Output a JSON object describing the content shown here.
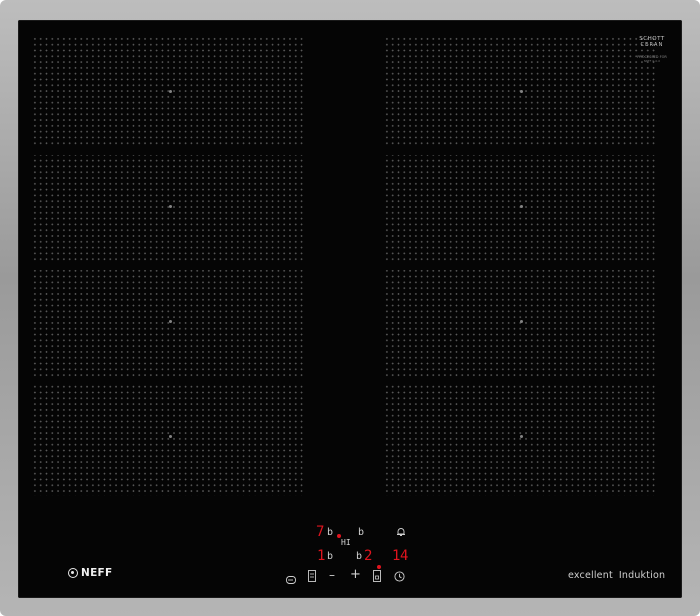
{
  "hob": {
    "colors": {
      "glass": "#050505",
      "frame": "#a8a8a8",
      "display_red": "#e0141e",
      "control_grey": "#d0d0d0"
    },
    "glass_label": {
      "maker_line1": "SCHOTT",
      "maker_line2": "CERAN",
      "small_line1": "PROCESSED FOR",
      "small_line2": "NEFF 0-0-0"
    },
    "displays": {
      "top_left_digit": "7",
      "top_left_b": "b",
      "top_hi": "HI",
      "top_right_b": "b",
      "bottom_left_digit": "1",
      "bottom_left_b": "b",
      "bottom_mid_b": "b",
      "bottom_power": "2",
      "timer_1": "1",
      "timer_2": "4"
    },
    "controls": {
      "flex_icon": "flex-zone-icon",
      "zone_select_icon": "zone-select-icon",
      "minus": "–",
      "plus": "+",
      "power_icon": "power-boost-icon",
      "timer_icon": "clock-icon",
      "bell_icon": "bell-icon"
    },
    "brand_logo": "NEFF",
    "product_line": "excellent",
    "product_type": "Induktion"
  }
}
